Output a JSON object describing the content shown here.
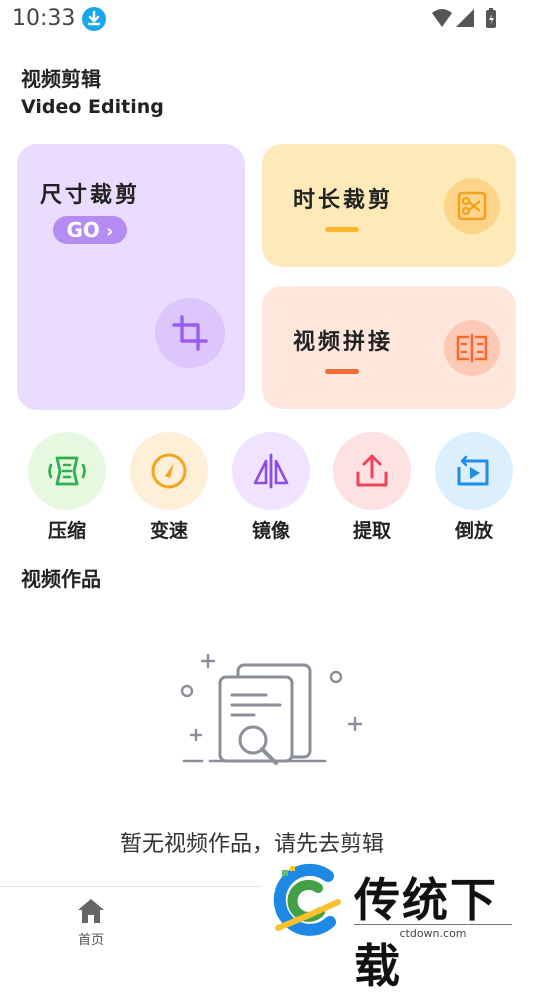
{
  "status_bar": {
    "time": "10:33"
  },
  "header": {
    "title": "视频剪辑",
    "subtitle": "Video Editing"
  },
  "cards": {
    "size_crop": {
      "title": "尺寸裁剪",
      "go_label": "GO",
      "icon": "crop-icon"
    },
    "duration_crop": {
      "title": "时长裁剪",
      "icon": "scissors-icon",
      "accent": "#fbb62a"
    },
    "merge": {
      "title": "视频拼接",
      "icon": "film-merge-icon",
      "accent": "#f26a35"
    }
  },
  "tools": [
    {
      "label": "压缩",
      "icon": "compress-icon",
      "color": "#2eb04f",
      "bg": "#e6f8df"
    },
    {
      "label": "变速",
      "icon": "speed-icon",
      "color": "#f3a51c",
      "bg": "#fdefd8"
    },
    {
      "label": "镜像",
      "icon": "mirror-icon",
      "color": "#8b4de6",
      "bg": "#efe3ff"
    },
    {
      "label": "提取",
      "icon": "extract-icon",
      "color": "#f0445a",
      "bg": "#fde1e3"
    },
    {
      "label": "倒放",
      "icon": "reverse-icon",
      "color": "#1e8ee6",
      "bg": "#dcefff"
    }
  ],
  "works": {
    "title": "视频作品",
    "empty_text": "暂无视频作品，请先去剪辑"
  },
  "bottom_nav": {
    "home_label": "首页"
  },
  "watermark": {
    "brand": "传统下载",
    "url": "ctdown.com"
  }
}
